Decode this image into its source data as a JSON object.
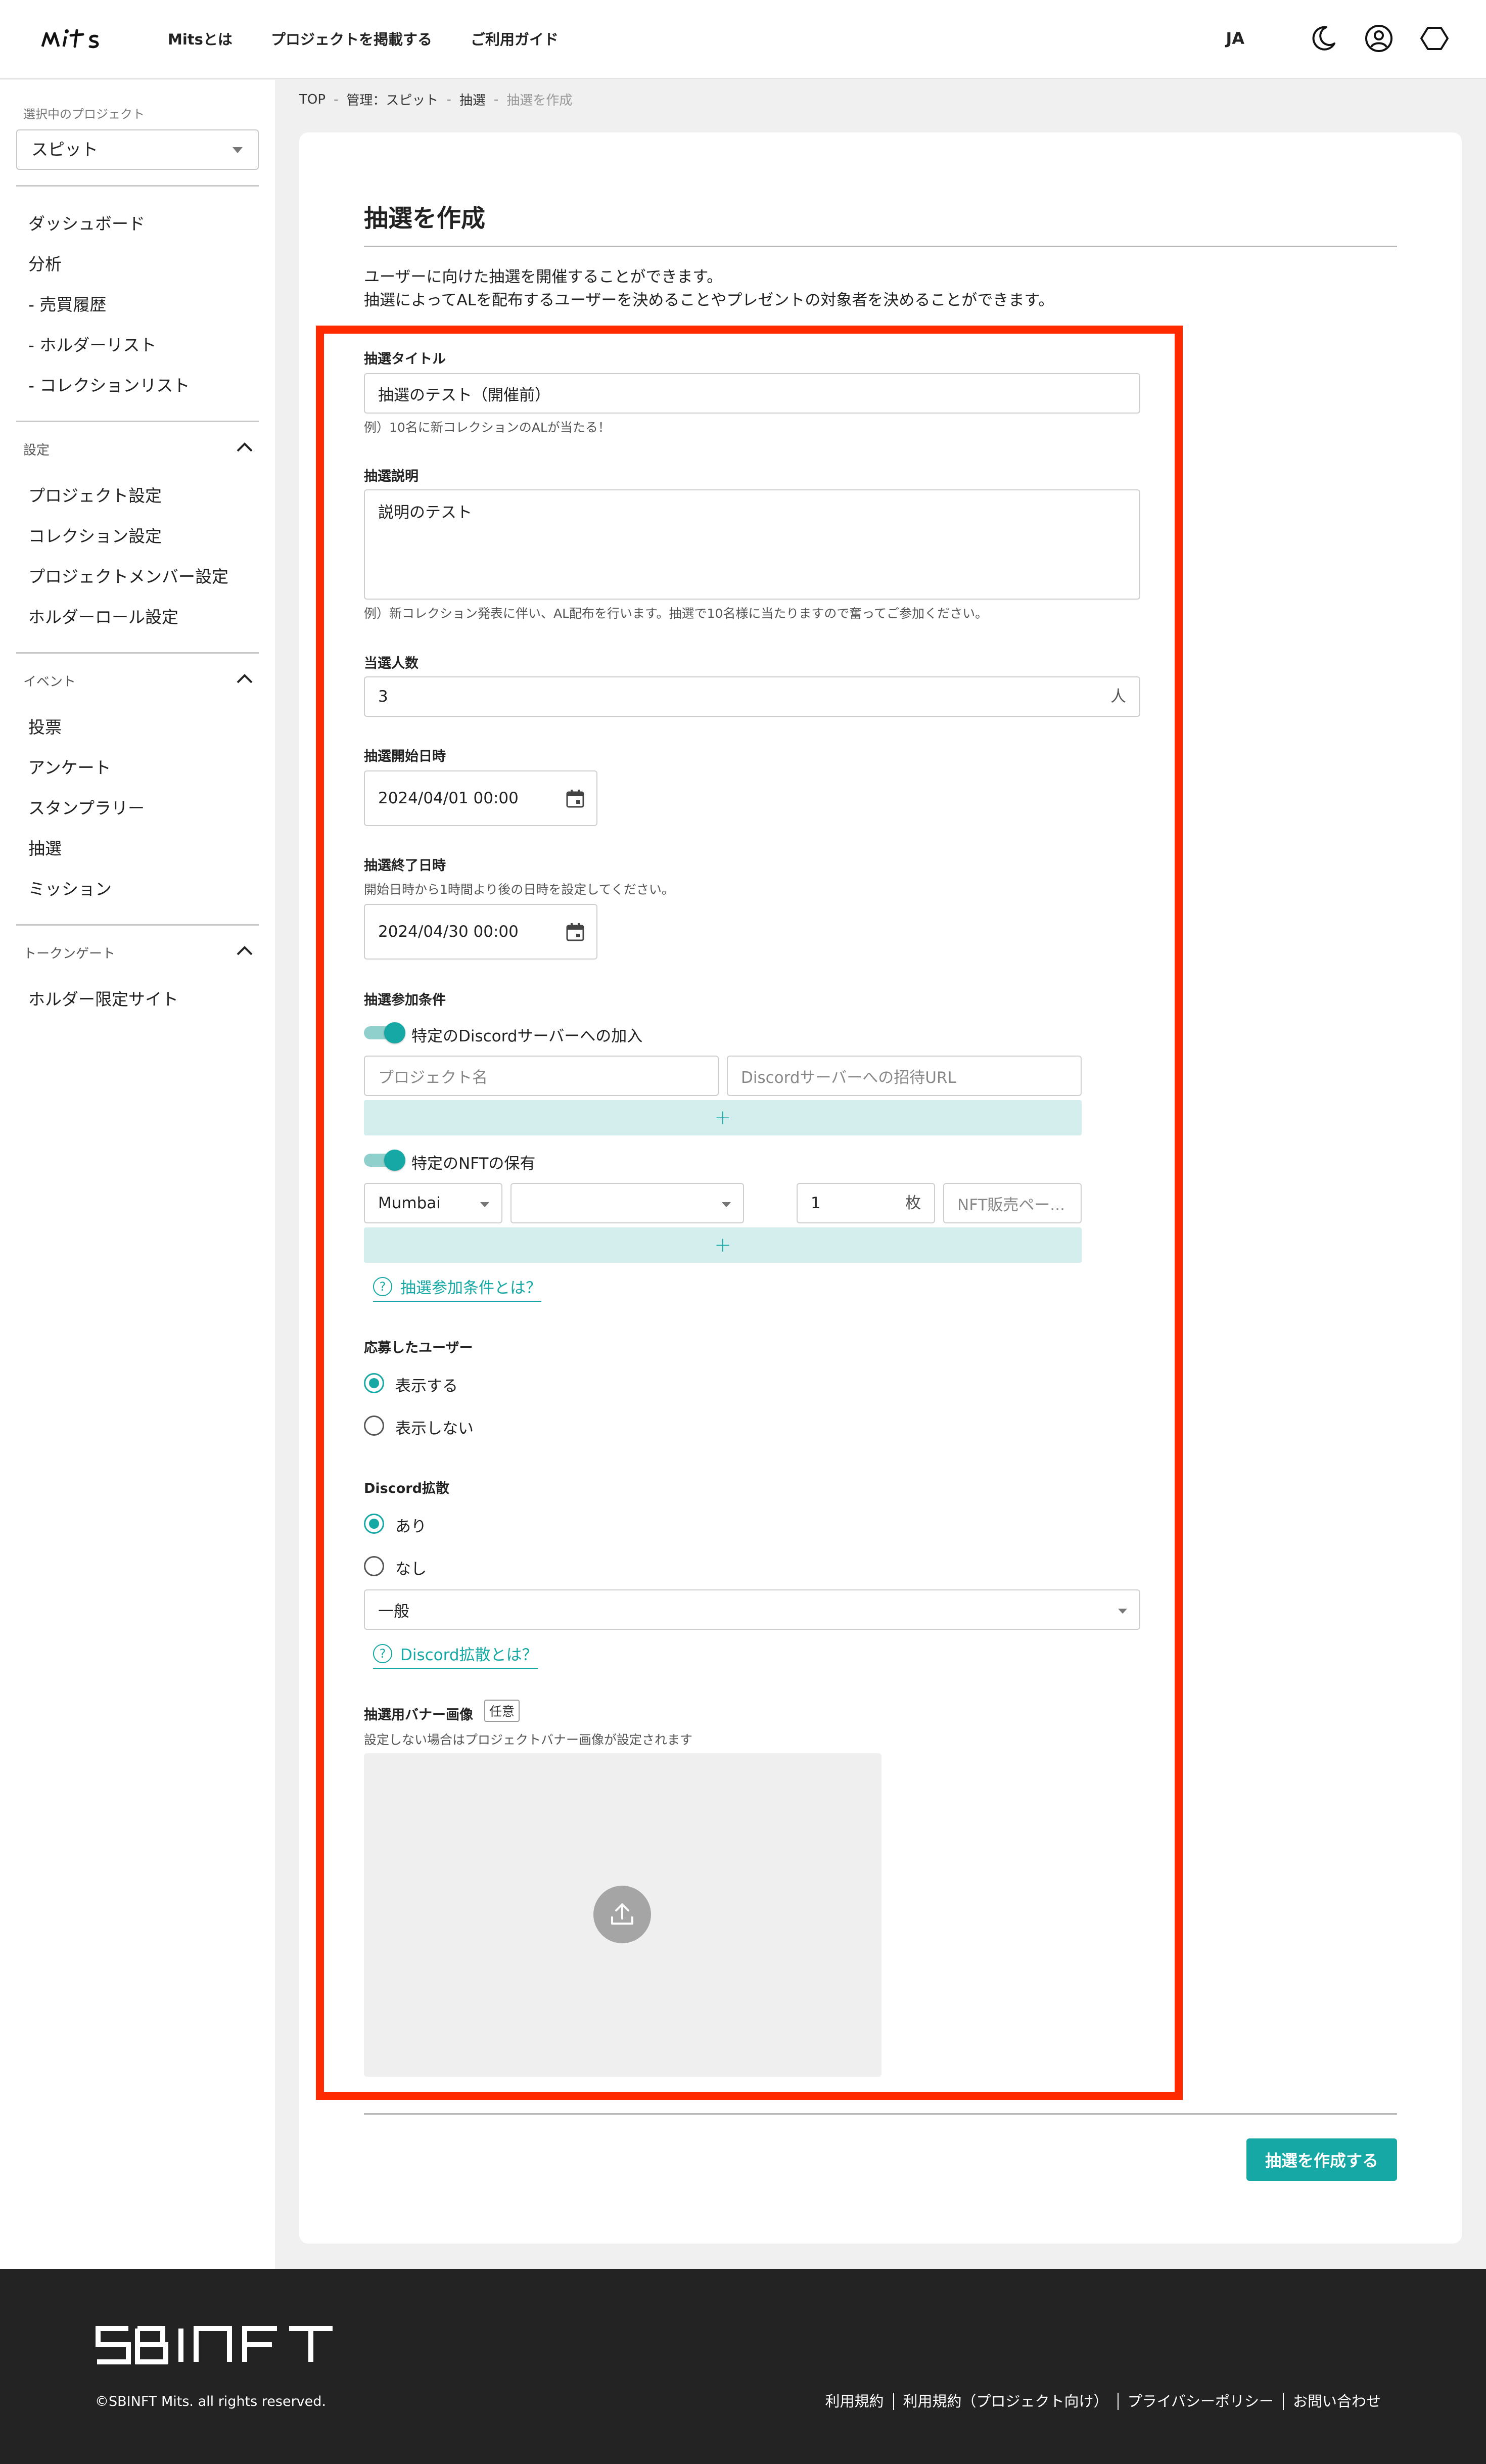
{
  "header": {
    "nav": [
      "Mitsとは",
      "プロジェクトを掲載する",
      "ご利用ガイド"
    ],
    "lang": "JA",
    "icons": [
      "moon-icon",
      "user-circle-icon",
      "hexagon-icon"
    ]
  },
  "sidebar": {
    "project_caption": "選択中のプロジェクト",
    "project_value": "スピット",
    "main_items": [
      "ダッシュボード",
      "分析",
      "- 売買履歴",
      "- ホルダーリスト",
      "- コレクションリスト"
    ],
    "settings_title": "設定",
    "settings_items": [
      "プロジェクト設定",
      "コレクション設定",
      "プロジェクトメンバー設定",
      "ホルダーロール設定"
    ],
    "event_title": "イベント",
    "event_items": [
      "投票",
      "アンケート",
      "スタンプラリー",
      "抽選",
      "ミッション"
    ],
    "token_title": "トークンゲート",
    "token_items": [
      "ホルダー限定サイト"
    ]
  },
  "breadcrumb": [
    "TOP",
    "管理：スピット",
    "抽選",
    "抽選を作成"
  ],
  "page": {
    "title": "抽選を作成",
    "desc1": "ユーザーに向けた抽選を開催することができます。",
    "desc2": "抽選によってALを配布するユーザーを決めることやプレゼントの対象者を決めることができます。"
  },
  "form": {
    "title_label": "抽選タイトル",
    "title_value": "抽選のテスト（開催前）",
    "title_hint": "例）10名に新コレクションのALが当たる！",
    "desc_label": "抽選説明",
    "desc_value": "説明のテスト",
    "desc_hint": "例）新コレクション発表に伴い、AL配布を行います。抽選で10名様に当たりますので奮ってご参加ください。",
    "winners_label": "当選人数",
    "winners_value": "3",
    "winners_suffix": "人",
    "start_label": "抽選開始日時",
    "start_value": "2024/04/01 00:00",
    "end_label": "抽選終了日時",
    "end_hint": "開始日時から1時間より後の日時を設定してください。",
    "end_value": "2024/04/30 00:00",
    "conditions_label": "抽選参加条件",
    "discord_toggle_label": "特定のDiscordサーバーへの加入",
    "discord_toggle_on": true,
    "project_name_placeholder": "プロジェクト名",
    "invite_url_placeholder": "Discordサーバーへの招待URL",
    "add_symbol": "+",
    "nft_toggle_label": "特定のNFTの保有",
    "nft_toggle_on": true,
    "network_value": "Mumbai",
    "collection_value": "",
    "count_value": "1",
    "count_suffix": "枚",
    "nft_page_placeholder": "NFT販売ペー...",
    "conditions_help": "抽選参加条件とは？",
    "applicants_label": "応募したユーザー",
    "applicants_options": [
      "表示する",
      "表示しない"
    ],
    "applicants_selected": 0,
    "discord_share_label": "Discord拡散",
    "discord_share_options": [
      "あり",
      "なし"
    ],
    "discord_share_selected": 0,
    "channel_value": "一般",
    "discord_share_help": "Discord拡散とは？",
    "banner_label": "抽選用バナー画像",
    "banner_badge": "任意",
    "banner_hint": "設定しない場合はプロジェクトバナー画像が設定されます",
    "submit_label": "抽選を作成する"
  },
  "footer": {
    "brand": "SBINFT",
    "copyright": "©SBINFT Mits. all rights reserved.",
    "links": [
      "利用規約",
      "利用規約（プロジェクト向け）",
      "プライバシーポリシー",
      "お問い合わせ"
    ]
  },
  "colors": {
    "accent": "#16a8a4",
    "highlight_frame": "#ff2a00",
    "footer_bg": "#232323"
  }
}
